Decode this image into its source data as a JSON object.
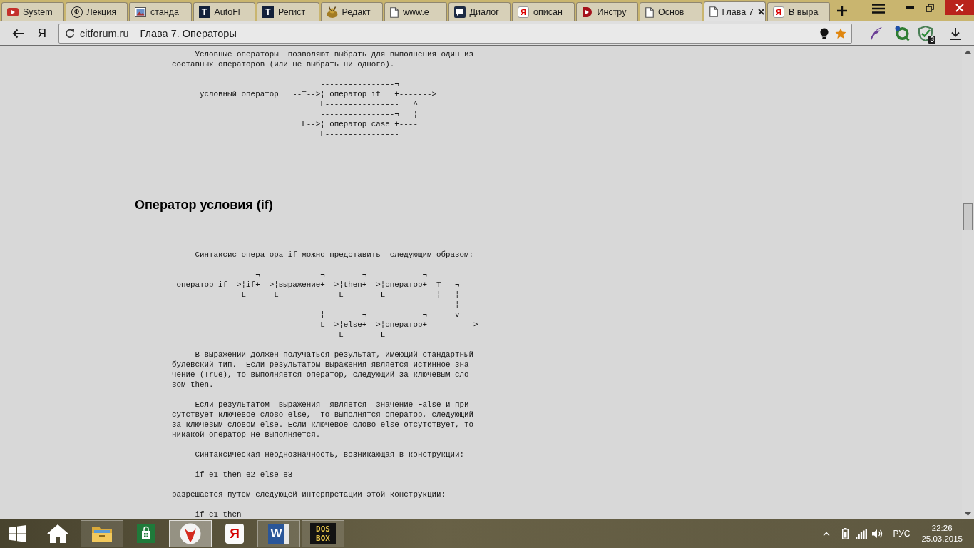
{
  "tab_strip": {
    "tabs": [
      {
        "title": "System",
        "selected": false
      },
      {
        "title": "Лекция",
        "icon_text": "Ф",
        "selected": false
      },
      {
        "title": "станда",
        "selected": false
      },
      {
        "title": "AutoFl",
        "icon_text": "T",
        "selected": false
      },
      {
        "title": "Регист",
        "icon_text": "T",
        "selected": false
      },
      {
        "title": "Редакт",
        "selected": false
      },
      {
        "title": "www.e",
        "selected": false
      },
      {
        "title": "Диалог",
        "selected": false
      },
      {
        "title": "описан",
        "icon_text": "Я",
        "selected": false
      },
      {
        "title": "Инстру",
        "selected": false
      },
      {
        "title": "Основ",
        "selected": false
      },
      {
        "title": "Глава 7",
        "selected": true
      },
      {
        "title": "В выра",
        "icon_text": "Я",
        "selected": false
      }
    ]
  },
  "toolbar": {
    "logo": "Я",
    "address": {
      "domain": "citforum.ru",
      "page_title": "Глава 7. Операторы"
    },
    "extension_badge": "3"
  },
  "page": {
    "blocks": [
      {
        "kind": "paragraph",
        "text": "Условные операторы  позволяют выбрать для выполнения один из\nсоставных операторов (или не выбрать ни одного)."
      },
      {
        "kind": "diagram",
        "lines": [
          "                                ----------------¬",
          "      условный оператор   --T-->¦ оператор if   +------->",
          "                            ¦   L----------------   ^",
          "                            ¦   ----------------¬   ¦",
          "                            L-->¦ оператор case +----",
          "                                L----------------"
        ]
      },
      {
        "kind": "heading",
        "text": "Оператор условия (if)"
      },
      {
        "kind": "paragraph",
        "text": "Синтаксис оператора if можно представить  следующим образом:"
      },
      {
        "kind": "diagram",
        "lines": [
          "               ---¬   ----------¬   -----¬   ---------¬",
          " оператор if ->¦if+-->¦выражение+-->¦then+-->¦оператор+--T---¬",
          "               L---   L----------   L-----   L---------  ¦   ¦",
          "                                --------------------------   ¦",
          "                                ¦   -----¬   ---------¬      v",
          "                                L-->¦else+-->¦оператор+---------->",
          "                                    L-----   L---------"
        ]
      },
      {
        "kind": "paragraph",
        "text": "В выражении должен получаться результат, имеющий стандартный\nбулевский тип.  Если результатом выражения является истинное зна-\nчение (True), то выполняется оператор, следующий за ключевым сло-\nвом then."
      },
      {
        "kind": "paragraph",
        "text": "Если результатом  выражения  является  значение False и при-\nсутствует ключевое слово else,  то выполнятся оператор, следующий\nза ключевым словом else. Если ключевое слово else отсутствует, то\nникакой оператор не выполняется."
      },
      {
        "kind": "paragraph",
        "text": "Синтаксическая неоднозначность, возникающая в конструкции:"
      },
      {
        "kind": "code",
        "text": "if e1 then e2 else e3"
      },
      {
        "kind": "continuation",
        "text": "разрешается путем следующей интерпретации этой конструкции:"
      },
      {
        "kind": "code",
        "text": "if e1 then"
      }
    ]
  },
  "taskbar": {
    "apps": [
      {
        "running": false,
        "selected": false
      },
      {
        "running": true,
        "selected": false
      },
      {
        "running": false,
        "selected": false
      },
      {
        "running": true,
        "selected": true
      },
      {
        "running": false,
        "selected": false,
        "glyph": "Я"
      },
      {
        "running": true,
        "selected": false,
        "glyph": "W"
      },
      {
        "running": true,
        "selected": false,
        "glyph": "DOS\nBOX"
      }
    ],
    "tray": {
      "language": "РУС",
      "time": "22:26",
      "date": "25.03.2015"
    }
  }
}
